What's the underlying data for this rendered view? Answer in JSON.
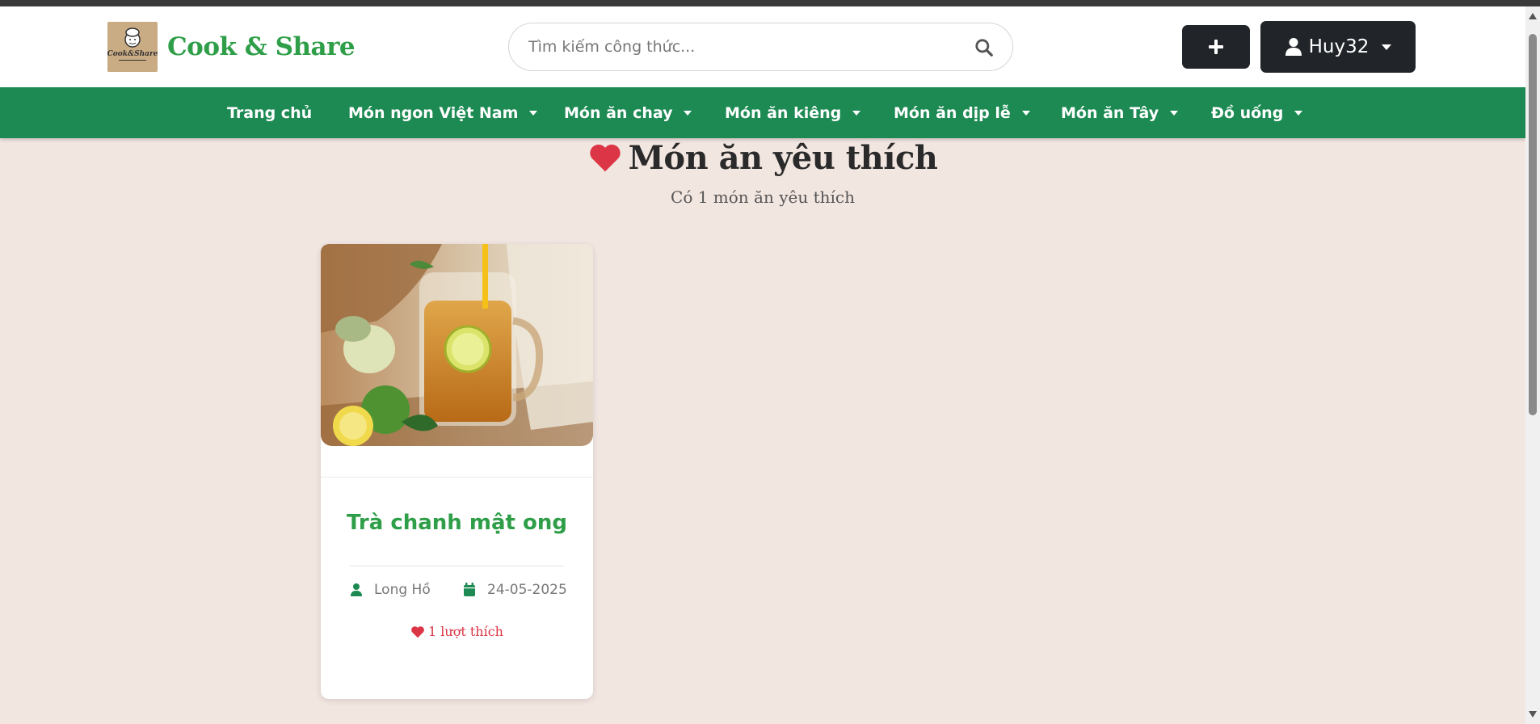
{
  "header": {
    "brand_name": "Cook & Share",
    "logo_text": "Cook&Share",
    "search": {
      "placeholder": "Tìm kiếm công thức..."
    },
    "user": {
      "username": "Huy32"
    }
  },
  "nav": {
    "items": [
      {
        "label": "Trang chủ",
        "has_dropdown": false
      },
      {
        "label": "Món ngon Việt Nam",
        "has_dropdown": true
      },
      {
        "label": "Món ăn chay",
        "has_dropdown": true
      },
      {
        "label": "Món ăn kiêng",
        "has_dropdown": true
      },
      {
        "label": "Món ăn dịp lễ",
        "has_dropdown": true
      },
      {
        "label": "Món ăn Tây",
        "has_dropdown": true
      },
      {
        "label": "Đồ uống",
        "has_dropdown": true
      }
    ]
  },
  "page": {
    "title": "Món ăn yêu thích",
    "subtitle": "Có 1 món ăn yêu thích"
  },
  "recipes": [
    {
      "title": "Trà chanh mật ong",
      "author": "Long Hồ",
      "date": "24-05-2025",
      "likes": "1 lượt thích"
    }
  ],
  "colors": {
    "brand_green": "#2e9e48",
    "nav_green": "#1c8a52",
    "page_bg": "#f2e6e1",
    "dark_button": "#212529",
    "heart_red": "#dc3545"
  },
  "icons": {
    "search": "search-icon",
    "add": "plus-icon",
    "user": "user-icon",
    "heart": "heart-icon",
    "calendar": "calendar-icon"
  }
}
